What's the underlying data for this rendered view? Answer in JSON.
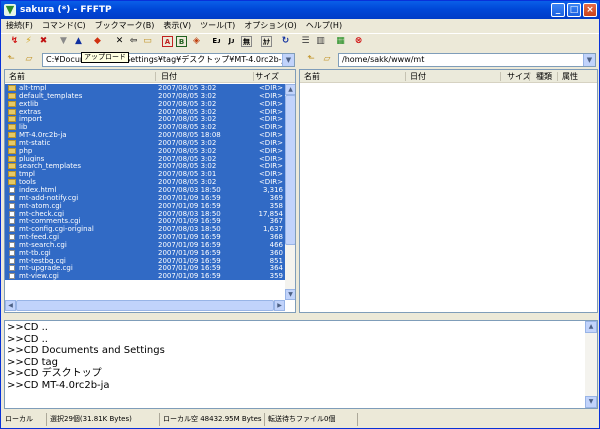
{
  "window": {
    "title": "sakura (*) - FFFTP",
    "min_glyph": "_",
    "max_glyph": "□",
    "close_glyph": "×"
  },
  "menu": [
    "接続(F)",
    "コマンド(C)",
    "ブックマーク(B)",
    "表示(V)",
    "ツール(T)",
    "オプション(O)",
    "ヘルプ(H)"
  ],
  "tooltip": "アップロード",
  "local": {
    "path": "C:¥Documents and Settings¥tag¥デスクトップ¥MT-4.0rc2b-ja",
    "columns": {
      "name": "名前",
      "date": "日付",
      "size": "サイズ"
    },
    "files": [
      {
        "name": "alt-tmpl",
        "date": "2007/08/05  3:02",
        "size": "<DIR>",
        "type": "folder"
      },
      {
        "name": "default_templates",
        "date": "2007/08/05  3:02",
        "size": "<DIR>",
        "type": "folder"
      },
      {
        "name": "extlib",
        "date": "2007/08/05  3:02",
        "size": "<DIR>",
        "type": "folder"
      },
      {
        "name": "extras",
        "date": "2007/08/05  3:02",
        "size": "<DIR>",
        "type": "folder"
      },
      {
        "name": "import",
        "date": "2007/08/05  3:02",
        "size": "<DIR>",
        "type": "folder"
      },
      {
        "name": "lib",
        "date": "2007/08/05  3:02",
        "size": "<DIR>",
        "type": "folder"
      },
      {
        "name": "MT-4.0rc2b-ja",
        "date": "2007/08/05 18:08",
        "size": "<DIR>",
        "type": "folder"
      },
      {
        "name": "mt-static",
        "date": "2007/08/05  3:02",
        "size": "<DIR>",
        "type": "folder"
      },
      {
        "name": "php",
        "date": "2007/08/05  3:02",
        "size": "<DIR>",
        "type": "folder"
      },
      {
        "name": "plugins",
        "date": "2007/08/05  3:02",
        "size": "<DIR>",
        "type": "folder"
      },
      {
        "name": "search_templates",
        "date": "2007/08/05  3:02",
        "size": "<DIR>",
        "type": "folder"
      },
      {
        "name": "tmpl",
        "date": "2007/08/05  3:01",
        "size": "<DIR>",
        "type": "folder"
      },
      {
        "name": "tools",
        "date": "2007/08/05  3:02",
        "size": "<DIR>",
        "type": "folder"
      },
      {
        "name": "index.html",
        "date": "2007/08/03 18:50",
        "size": "3,316",
        "type": "file"
      },
      {
        "name": "mt-add-notify.cgi",
        "date": "2007/01/09 16:59",
        "size": "369",
        "type": "file"
      },
      {
        "name": "mt-atom.cgi",
        "date": "2007/01/09 16:59",
        "size": "358",
        "type": "file"
      },
      {
        "name": "mt-check.cgi",
        "date": "2007/08/03 18:50",
        "size": "17,854",
        "type": "file"
      },
      {
        "name": "mt-comments.cgi",
        "date": "2007/01/09 16:59",
        "size": "367",
        "type": "file"
      },
      {
        "name": "mt-config.cgi-original",
        "date": "2007/08/03 18:50",
        "size": "1,637",
        "type": "file"
      },
      {
        "name": "mt-feed.cgi",
        "date": "2007/01/09 16:59",
        "size": "368",
        "type": "file"
      },
      {
        "name": "mt-search.cgi",
        "date": "2007/01/09 16:59",
        "size": "466",
        "type": "file"
      },
      {
        "name": "mt-tb.cgi",
        "date": "2007/01/09 16:59",
        "size": "360",
        "type": "file"
      },
      {
        "name": "mt-testbg.cgi",
        "date": "2007/01/09 16:59",
        "size": "851",
        "type": "file"
      },
      {
        "name": "mt-upgrade.cgi",
        "date": "2007/01/09 16:59",
        "size": "364",
        "type": "file"
      },
      {
        "name": "mt-view.cgi",
        "date": "2007/01/09 16:59",
        "size": "359",
        "type": "file"
      }
    ]
  },
  "remote": {
    "path": "/home/sakk/www/mt",
    "columns": {
      "name": "名前",
      "date": "日付",
      "size": "サイズ",
      "kind": "種類",
      "attr": "属性"
    }
  },
  "log": [
    ">>CD ..",
    ">>CD ..",
    ">>CD Documents and Settings",
    ">>CD tag",
    ">>CD デスクトップ",
    ">>CD MT-4.0rc2b-ja"
  ],
  "status": {
    "local": "ローカル",
    "selected": "選択29個(31.81K Bytes)",
    "free": "ローカル空 48432.95M Bytes",
    "queue": "転送待ちファイル0個"
  }
}
